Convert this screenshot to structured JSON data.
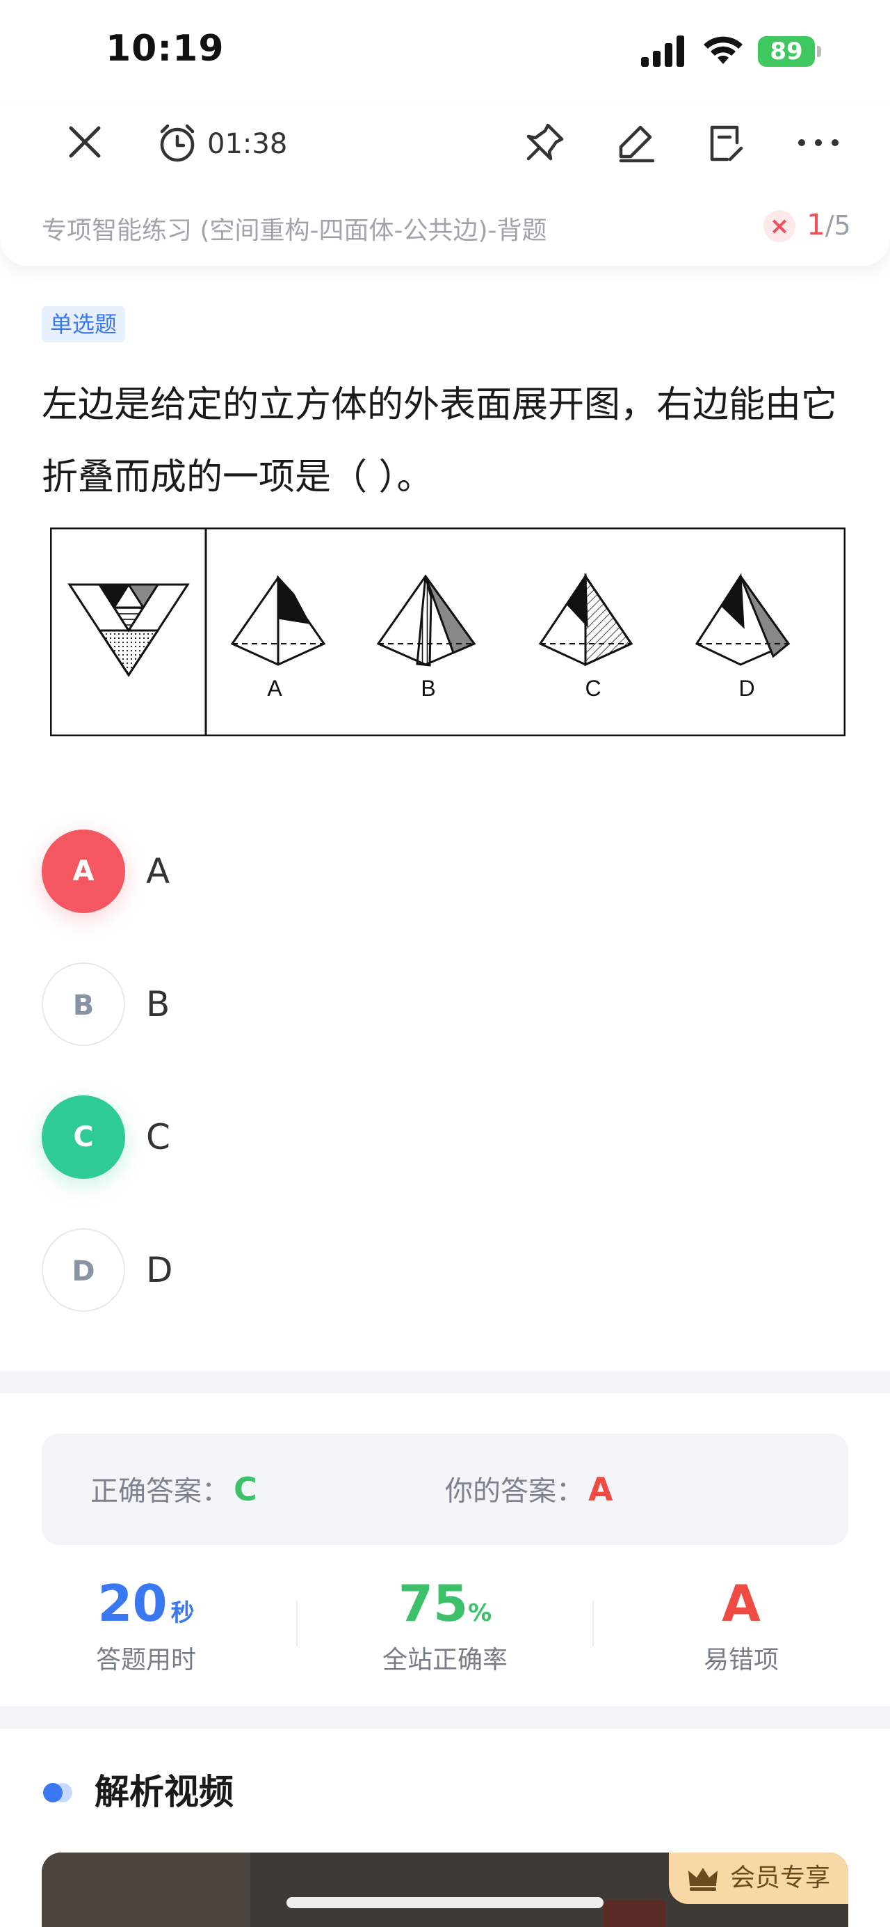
{
  "status_bar": {
    "time": "10:19",
    "battery": "89"
  },
  "header": {
    "timer": "01:38",
    "subtitle": "专项智能练习 (空间重构-四面体-公共边)-背题",
    "wrong_mark": "×",
    "page_current": "1",
    "page_total": "/5",
    "icons": [
      "close-icon",
      "alarm-clock-icon",
      "pin-icon",
      "edit-icon",
      "note-icon",
      "more-icon"
    ]
  },
  "question": {
    "type": "单选题",
    "text": "左边是给定的立方体的外表面展开图，右边能由它折叠而成的一项是（    ）。",
    "figure_labels": [
      "A",
      "B",
      "C",
      "D"
    ]
  },
  "options": [
    {
      "letter": "A",
      "label": "A",
      "state": "wrong"
    },
    {
      "letter": "B",
      "label": "B",
      "state": "normal"
    },
    {
      "letter": "C",
      "label": "C",
      "state": "correct"
    },
    {
      "letter": "D",
      "label": "D",
      "state": "normal"
    }
  ],
  "answer": {
    "correct_label": "正确答案：",
    "correct_value": "C",
    "yours_label": "你的答案：",
    "yours_value": "A"
  },
  "stats": {
    "time_value": "20",
    "time_unit": "秒",
    "time_label": "答题用时",
    "rate_value": "75",
    "rate_unit": "%",
    "rate_label": "全站正确率",
    "error_value": "A",
    "error_label": "易错项"
  },
  "analysis": {
    "title": "解析视频",
    "vip_label": "会员专享"
  },
  "colors": {
    "wrong": "#f4575f",
    "correct": "#2ecc94",
    "accent_blue": "#3a78f2",
    "stat_green": "#3cc06a",
    "stat_red": "#ef4b43"
  }
}
